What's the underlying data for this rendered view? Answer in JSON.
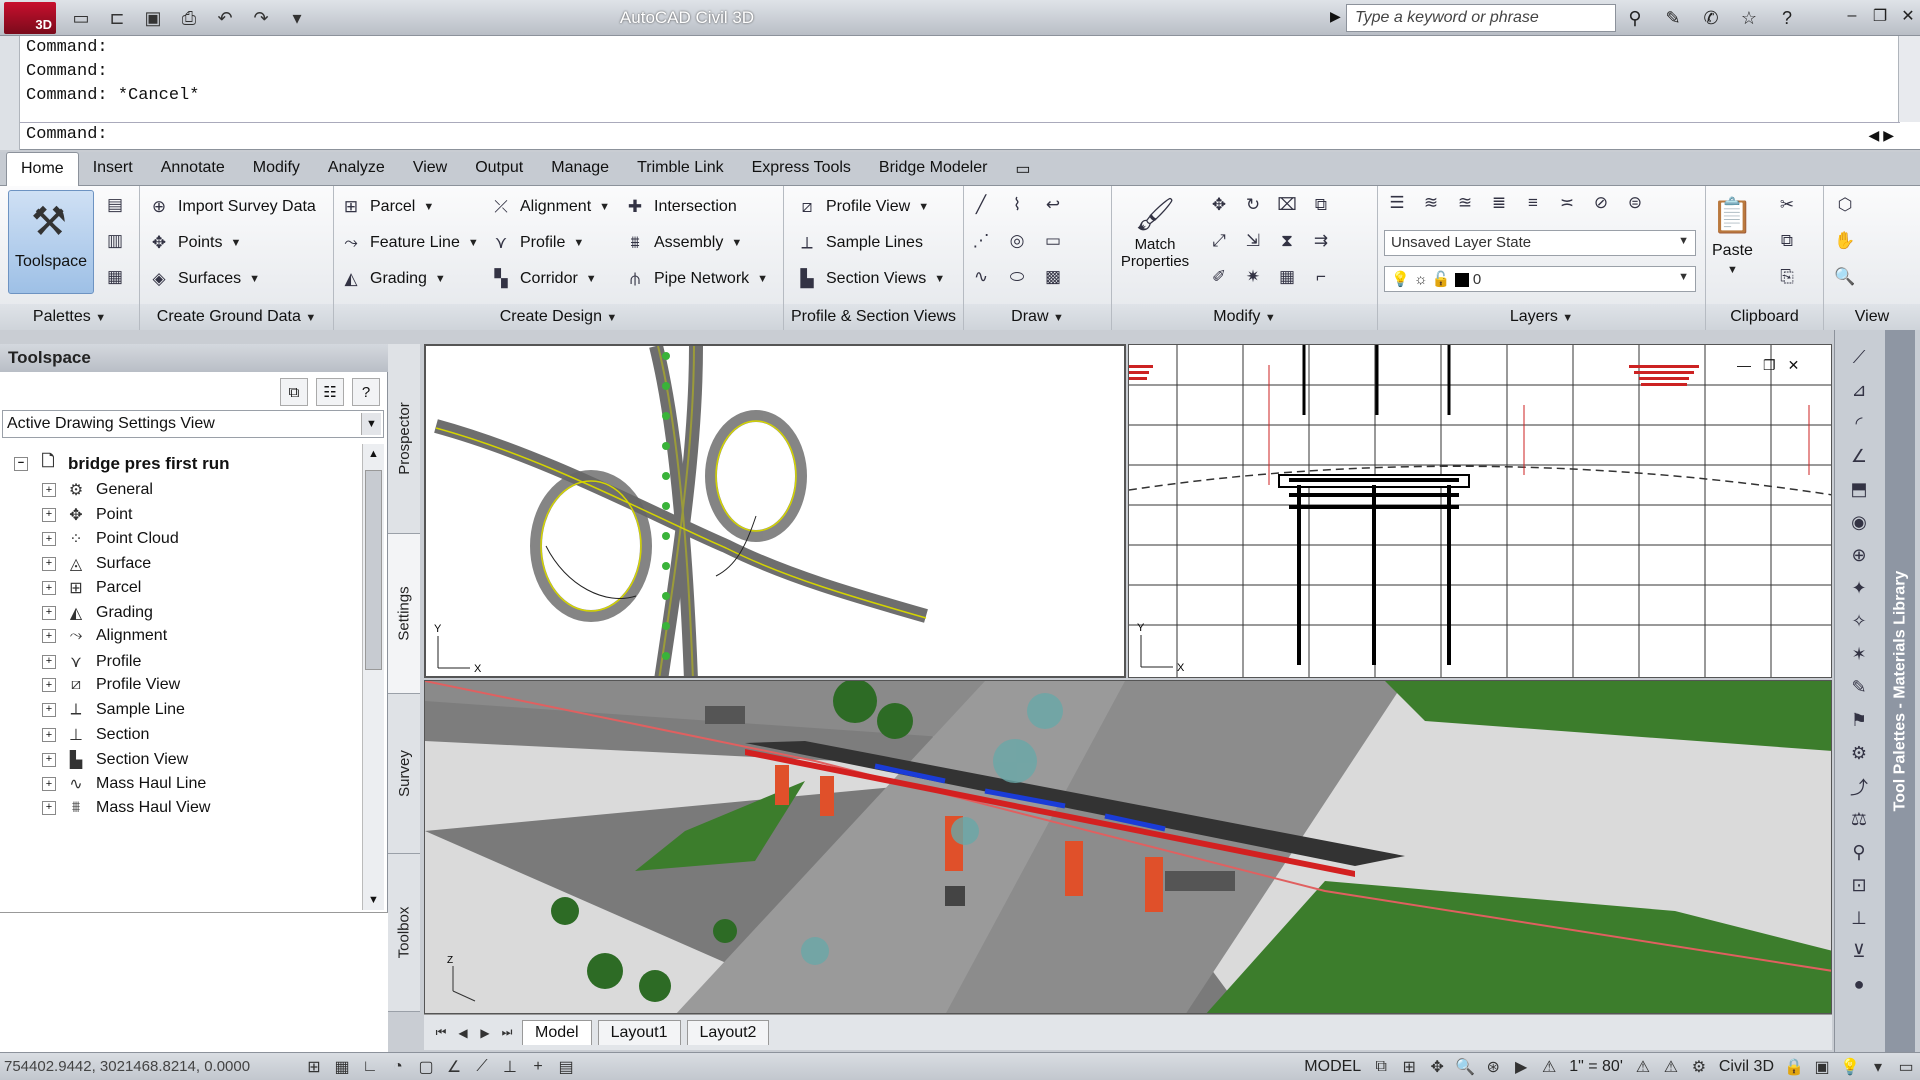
{
  "app": {
    "title": "AutoCAD Civil 3D",
    "icon_badge": "3D"
  },
  "search": {
    "placeholder": "Type a keyword or phrase"
  },
  "command": {
    "lines": [
      "Command:",
      "Command:",
      "Command:  *Cancel*"
    ],
    "prompt": "Command:"
  },
  "ribbon_tabs": [
    "Home",
    "Insert",
    "Annotate",
    "Modify",
    "Analyze",
    "View",
    "Output",
    "Manage",
    "Trimble Link",
    "Express Tools",
    "Bridge Modeler"
  ],
  "palettes": {
    "toolspace": "Toolspace",
    "title": "Palettes"
  },
  "ground": {
    "title": "Create Ground Data",
    "items": [
      "Import Survey Data",
      "Points",
      "Surfaces"
    ]
  },
  "design": {
    "title": "Create Design",
    "col1": [
      "Parcel",
      "Feature Line",
      "Grading"
    ],
    "col2": [
      "Alignment",
      "Profile",
      "Corridor"
    ],
    "col3": [
      "Intersection",
      "Assembly",
      "Pipe Network"
    ]
  },
  "profile_section": {
    "title": "Profile & Section Views",
    "items": [
      "Profile View",
      "Sample Lines",
      "Section Views"
    ]
  },
  "draw": {
    "title": "Draw"
  },
  "modify": {
    "title": "Modify",
    "match": "Match Properties"
  },
  "layers": {
    "title": "Layers",
    "state": "Unsaved Layer State",
    "current": "0"
  },
  "clipboard": {
    "title": "Clipboard",
    "paste": "Paste"
  },
  "view_panel": {
    "title": "View"
  },
  "toolspace": {
    "title": "Toolspace",
    "view": "Active Drawing Settings View",
    "root": "bridge pres first run",
    "items": [
      "General",
      "Point",
      "Point Cloud",
      "Surface",
      "Parcel",
      "Grading",
      "Alignment",
      "Profile",
      "Profile View",
      "Sample Line",
      "Section",
      "Section View",
      "Mass Haul Line",
      "Mass Haul View"
    ],
    "side_tabs": [
      "Prospector",
      "Settings",
      "Survey",
      "Toolbox"
    ]
  },
  "viewports": {
    "axis_y": "Y",
    "axis_x": "X",
    "axis_z": "Z"
  },
  "layout_tabs": [
    "Model",
    "Layout1",
    "Layout2"
  ],
  "right_palette": {
    "label": "Tool Palettes - Materials Library"
  },
  "status": {
    "coords": "754402.9442, 3021468.8214, 0.0000",
    "model": "MODEL",
    "scale": "1\" = 80'",
    "workspace": "Civil 3D"
  },
  "colors": {
    "accent": "#7aa7dc",
    "bridge_deck": "#e02020",
    "pier": "#e0502a",
    "grass": "#3c7d2c",
    "road": "#7a7a7a"
  }
}
